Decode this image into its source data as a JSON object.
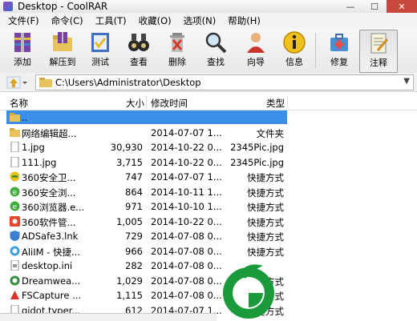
{
  "window": {
    "title": "Desktop - CoolRAR"
  },
  "menu": [
    "文件(F)",
    "命令(C)",
    "工具(T)",
    "收藏(O)",
    "选项(N)",
    "帮助(H)"
  ],
  "toolbar": [
    {
      "label": "添加",
      "icon": "archive-add-icon"
    },
    {
      "label": "解压到",
      "icon": "extract-folder-icon"
    },
    {
      "label": "测试",
      "icon": "test-check-icon"
    },
    {
      "label": "查看",
      "icon": "binoculars-icon"
    },
    {
      "label": "删除",
      "icon": "delete-bin-icon"
    },
    {
      "label": "查找",
      "icon": "magnifier-icon"
    },
    {
      "label": "向导",
      "icon": "wizard-user-icon"
    },
    {
      "label": "信息",
      "icon": "info-icon"
    },
    {
      "label": "修复",
      "icon": "repair-kit-icon"
    },
    {
      "label": "注释",
      "icon": "comment-note-icon"
    }
  ],
  "address": {
    "path": "C:\\Users\\Administrator\\Desktop"
  },
  "columns": {
    "name": "名称",
    "size": "大小",
    "modified": "修改时间",
    "type": "类型"
  },
  "files": [
    {
      "name": "..",
      "size": "",
      "date": "",
      "type": "",
      "icon": "parent-folder-icon",
      "selected": true
    },
    {
      "name": "网络编辑超...",
      "size": "",
      "date": "2014-07-07 1...",
      "type": "文件夹",
      "icon": "folder-icon"
    },
    {
      "name": "1.jpg",
      "size": "30,930",
      "date": "2014-10-22 0...",
      "type": "2345Pic.jpg",
      "icon": "document-icon"
    },
    {
      "name": "111.jpg",
      "size": "3,715",
      "date": "2014-10-22 0...",
      "type": "2345Pic.jpg",
      "icon": "document-icon"
    },
    {
      "name": "360安全卫...",
      "size": "747",
      "date": "2014-07-07 1...",
      "type": "快捷方式",
      "icon": "shield-360-icon"
    },
    {
      "name": "360安全浏...",
      "size": "864",
      "date": "2014-10-11 1...",
      "type": "快捷方式",
      "icon": "browser-e-icon"
    },
    {
      "name": "360浏览器.e...",
      "size": "971",
      "date": "2014-10-10 1...",
      "type": "快捷方式",
      "icon": "browser-e-icon"
    },
    {
      "name": "360软件管...",
      "size": "1,005",
      "date": "2014-10-22 0...",
      "type": "快捷方式",
      "icon": "app-manager-icon"
    },
    {
      "name": "ADSafe3.lnk",
      "size": "729",
      "date": "2014-07-08 0...",
      "type": "快捷方式",
      "icon": "adsafe-icon"
    },
    {
      "name": "AliIM - 快捷...",
      "size": "966",
      "date": "2014-07-08 0...",
      "type": "快捷方式",
      "icon": "aliim-icon"
    },
    {
      "name": "desktop.ini",
      "size": "282",
      "date": "2014-07-08 0...",
      "type": "",
      "icon": "ini-file-icon"
    },
    {
      "name": "Dreamwea...",
      "size": "1,029",
      "date": "2014-07-08 0...",
      "type": "快捷方式",
      "icon": "dreamweaver-icon"
    },
    {
      "name": "FSCapture ...",
      "size": "1,115",
      "date": "2014-07-08 0...",
      "type": "快捷方式",
      "icon": "fscapture-icon"
    },
    {
      "name": "gidot.typer...",
      "size": "612",
      "date": "2014-07-07 1...",
      "type": "快捷方式",
      "icon": "document-icon"
    }
  ],
  "colors": {
    "selection": "#3b8fe6",
    "close_button": "#c7473b",
    "logo_green": "#1a9a3a"
  }
}
